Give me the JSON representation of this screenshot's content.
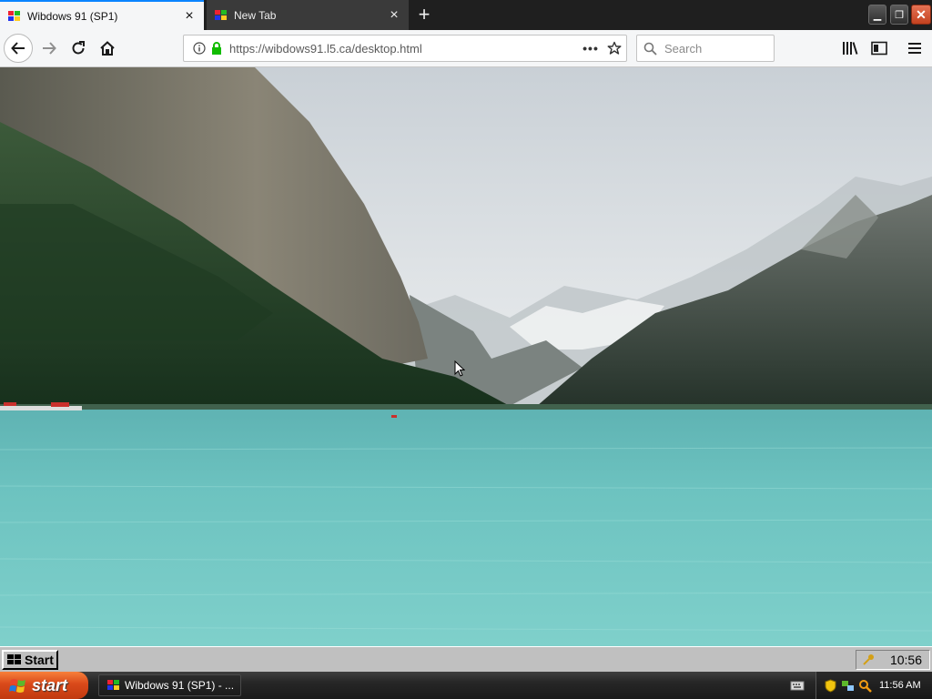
{
  "browser": {
    "tabs": [
      {
        "title": "Wibdows 91 (SP1)",
        "active": true
      },
      {
        "title": "New Tab",
        "active": false
      }
    ],
    "url": "https://wibdows91.l5.ca/desktop.html",
    "url_dots": "•••",
    "search": {
      "placeholder": "Search"
    }
  },
  "inner_taskbar": {
    "start_label": "Start",
    "clock": "10:56"
  },
  "host_taskbar": {
    "start_label": "start",
    "task_label": "Wibdows 91 (SP1) - ...",
    "clock": "11:56 AM"
  },
  "colors": {
    "accent_tab": "#0a84ff",
    "lock_green": "#12bc00",
    "xp_start": "#d9491a"
  },
  "icons": [
    "back-arrow-icon",
    "forward-arrow-icon",
    "reload-icon",
    "home-icon",
    "info-icon",
    "lock-icon",
    "star-icon",
    "search-icon",
    "library-icon",
    "sidebar-icon",
    "hamburger-menu-icon",
    "close-icon",
    "plus-icon",
    "minimize-icon",
    "restore-icon",
    "windows-logo-icon",
    "keyboard-icon",
    "shield-icon",
    "network-icon",
    "magnifier-icon",
    "key-icon",
    "mouse-cursor-icon"
  ]
}
